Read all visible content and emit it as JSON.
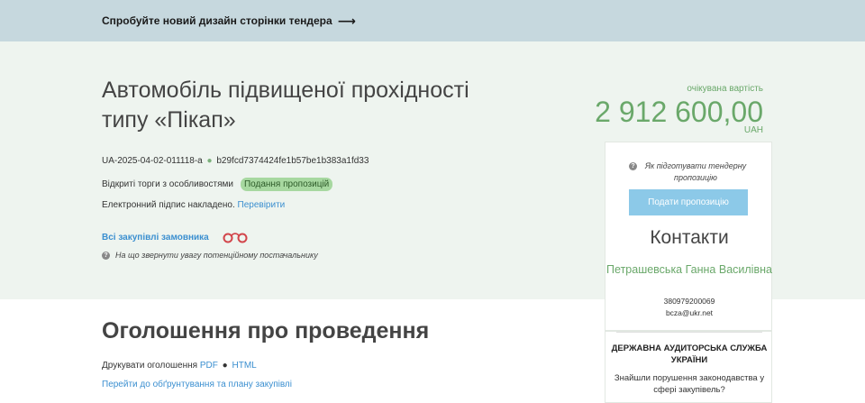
{
  "banner": {
    "text": "Спробуйте новий дизайн сторінки тендера",
    "arrow": "⟶"
  },
  "tender": {
    "title": "Автомобіль підвищеної прохідності типу «Пікап»",
    "id": "UA-2025-04-02-011118-a",
    "hash": "b29fcd7374424fe1b57be1b383a1fd33",
    "procedure": "Відкриті торги з особливостями",
    "status": "Подання пропозицій",
    "signature_text": "Електронний підпис накладено.",
    "signature_link": "Перевірити",
    "all_purchases": "Всі закупівлі замовника",
    "hint": "На що звернути увагу потенційному постачальнику"
  },
  "value": {
    "label": "очікувана вартість",
    "amount": "2 912 600,00",
    "currency": "UAH"
  },
  "card": {
    "hint": "Як підготувати тендерну пропозицію",
    "submit": "Подати пропозицію",
    "contacts_title": "Контакти",
    "contact_name": "Петрашевська Ганна Василівна",
    "phone": "380979200069",
    "email": "bcza@ukr.net"
  },
  "audit": {
    "title": "ДЕРЖАВНА АУДИТОРСЬКА СЛУЖБА УКРАЇНИ",
    "text": "Знайшли порушення законодавства у сфері закупівель?"
  },
  "announcement": {
    "title": "Оголошення про проведення",
    "print_label": "Друкувати оголошення",
    "pdf": "PDF",
    "html": "HTML",
    "plan_link": "Перейти до обґрунтування та плану закупівлі"
  },
  "colors": {
    "accent_green": "#6aa86a",
    "link_blue": "#3b8fd0",
    "button_blue": "#8cc9e8",
    "badge_green": "#a7d8a0"
  },
  "icons": {
    "banner_arrow": "arrow-right-icon",
    "hint": "question-circle-icon",
    "purchases": "handcuffs-icon"
  }
}
